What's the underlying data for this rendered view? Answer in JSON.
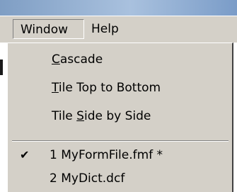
{
  "menubar": {
    "menus": [
      {
        "label": "Window"
      },
      {
        "label": "Help"
      }
    ]
  },
  "window_menu": {
    "items": [
      {
        "pre": "",
        "mnemonic": "C",
        "post": "ascade"
      },
      {
        "pre": "",
        "mnemonic": "T",
        "post": "ile Top to Bottom"
      },
      {
        "pre": "Tile ",
        "mnemonic": "S",
        "post": "ide by Side"
      }
    ],
    "open_windows": [
      {
        "label": "1 MyFormFile.fmf *",
        "checked": true,
        "check_glyph": "✔"
      },
      {
        "label": "2 MyDict.dcf",
        "checked": false
      }
    ]
  },
  "colors": {
    "menu_face": "#d4d0c8",
    "title_gradient": "#a9c1de"
  }
}
